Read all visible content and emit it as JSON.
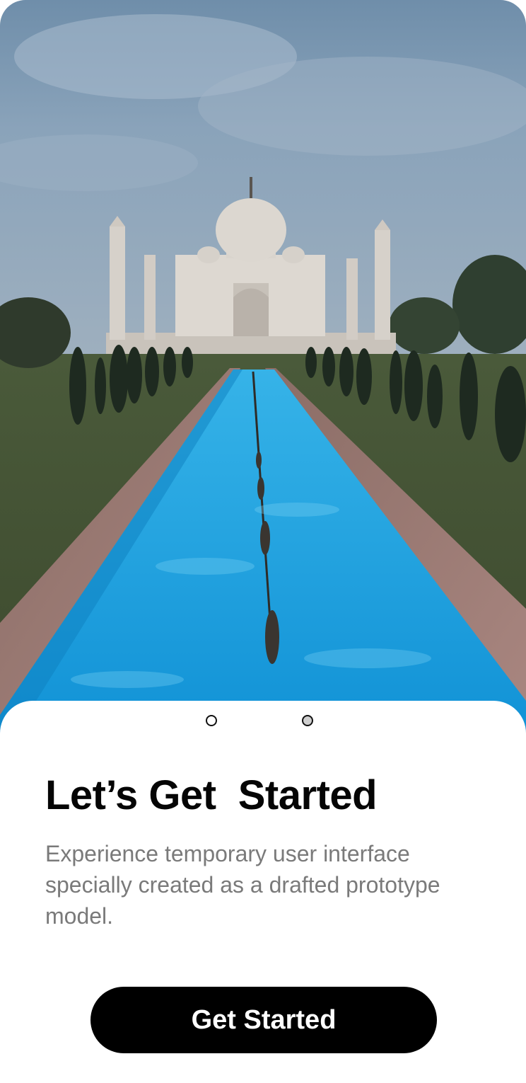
{
  "hero": {
    "image_description_icon": "taj-mahal-photo",
    "colors": {
      "sky": "#7d98b1",
      "pool": "#19a3e0",
      "marble": "#dcd8d2",
      "trees": "#1f2b22"
    }
  },
  "pagination": {
    "total": 2,
    "active_index": 0
  },
  "onboarding": {
    "title": "Let’s Get  Started",
    "subtitle": "Experience temporary user interface specially created as a drafted prototype model."
  },
  "actions": {
    "get_started_label": "Get Started"
  }
}
